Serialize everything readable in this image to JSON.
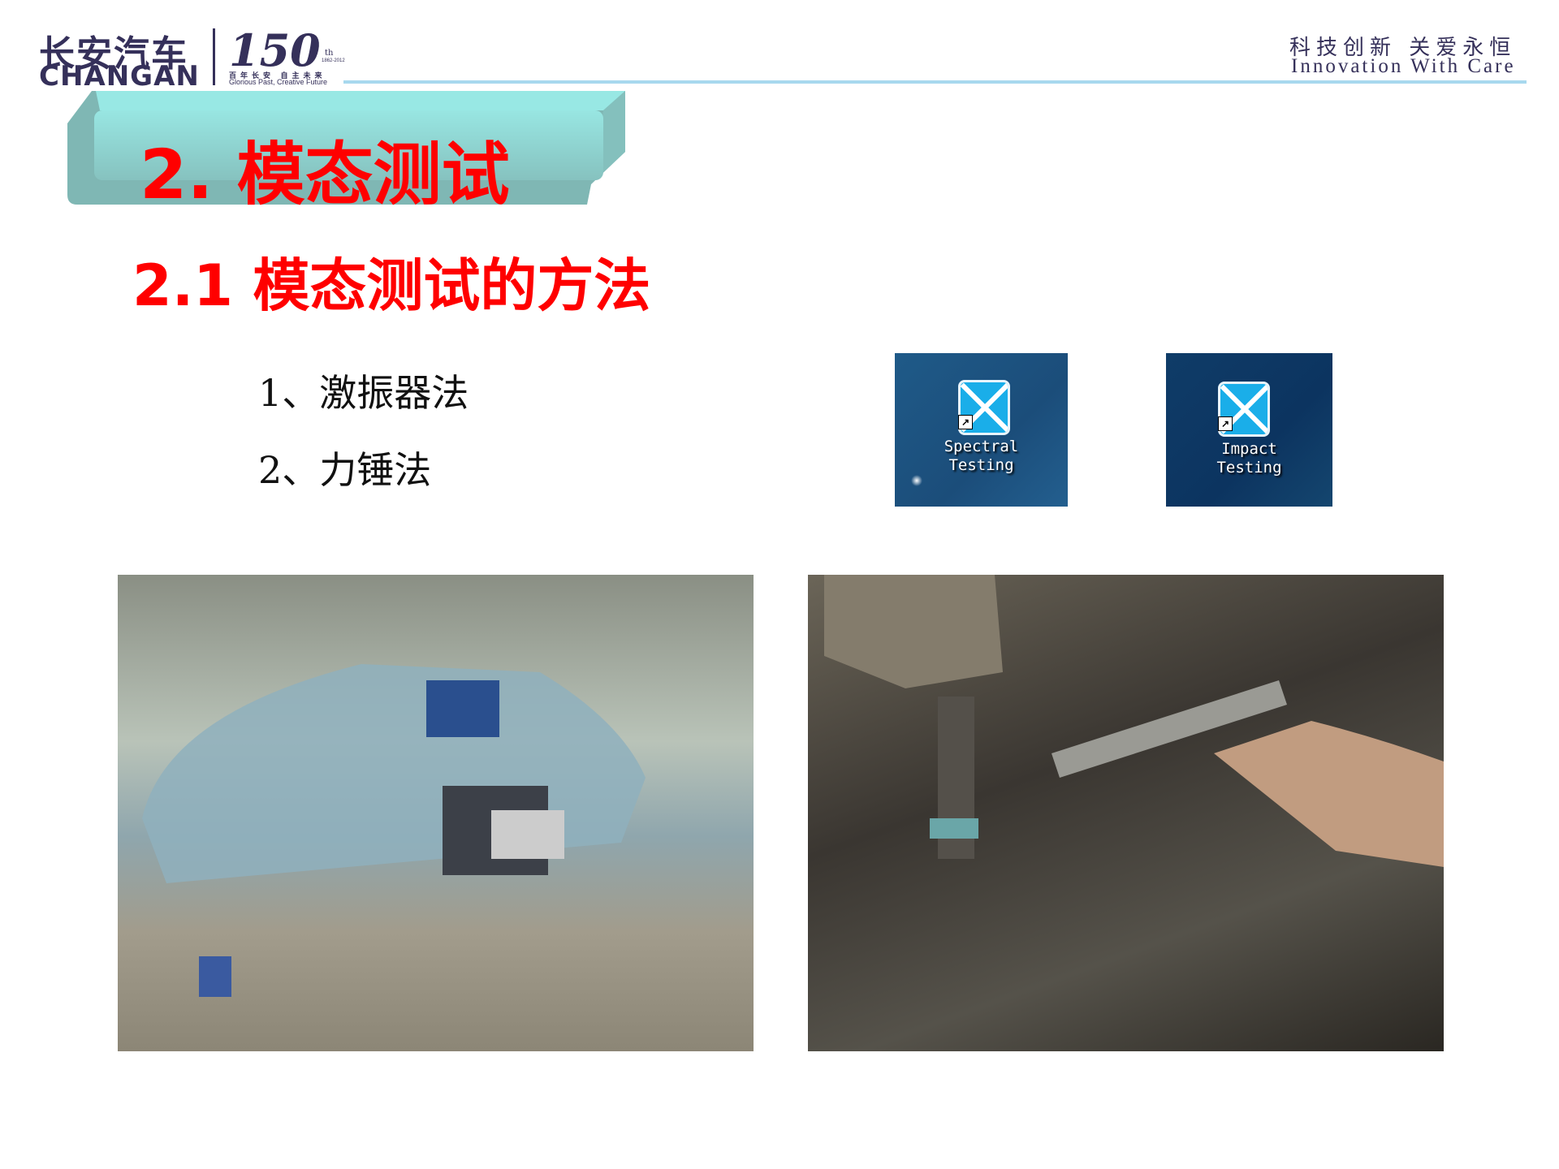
{
  "header": {
    "logo_cn": "长安汽车",
    "logo_en": "CHANGAN",
    "anniversary": "150",
    "anniversary_suffix": "th",
    "anniversary_years": "1862-2012",
    "anniversary_slogan_cn": "百年长安  自主未来",
    "anniversary_slogan_en": "Glorious Past, Creative Future",
    "tagline_cn": "科技创新  关爱永恒",
    "tagline_en": "Innovation With Care",
    "line_color": "#a8d8ee"
  },
  "title": "2.  模态测试",
  "subtitle": "2.1  模态测试的方法",
  "methods": [
    "1、激振器法",
    "2、力锤法"
  ],
  "software_icons": [
    {
      "icon": "spectral-testing-app-icon",
      "label_line1": "Spectral",
      "label_line2": "Testing"
    },
    {
      "icon": "impact-testing-app-icon",
      "label_line1": "Impact",
      "label_line2": "Testing"
    }
  ],
  "photos": [
    {
      "description_icon": "shaker-test-car-body-photo"
    },
    {
      "description_icon": "impact-hammer-photo"
    }
  ],
  "colors": {
    "title": "#ff0000",
    "brand": "#35305a",
    "title_box": "#8ecfcb"
  }
}
